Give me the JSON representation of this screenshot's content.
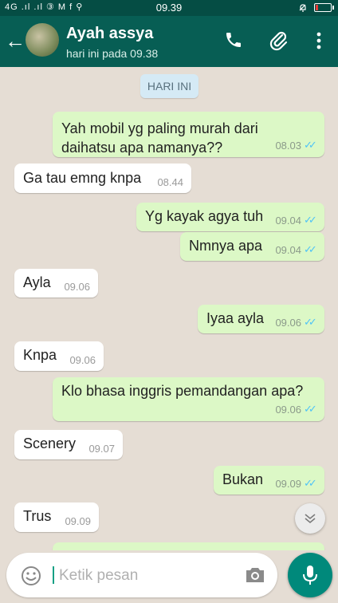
{
  "status_bar": {
    "left_indicators": "4G .ıl .ıl ③ M f ⚲",
    "time": "09.39",
    "battery_level_percent": 10,
    "icons": [
      "signal-icon",
      "mute-icon",
      "battery-icon"
    ]
  },
  "app_bar": {
    "contact_name": "Ayah assya",
    "last_seen": "hari ini pada 09.38",
    "icons": [
      "back-arrow-icon",
      "phone-icon",
      "paperclip-icon",
      "more-vert-icon"
    ]
  },
  "chat": {
    "date_chip": "HARI INI",
    "messages": [
      {
        "direction": "out",
        "lines": [
          "Yah mobil yg paling murah dari",
          "daihatsu apa namanya??"
        ],
        "time": "08.03",
        "status": "read"
      },
      {
        "direction": "in",
        "text": "Ga tau emng knpa",
        "time": "08.44"
      },
      {
        "direction": "out",
        "text": "Yg kayak agya tuh",
        "time": "09.04",
        "status": "read"
      },
      {
        "direction": "out",
        "text": "Nmnya apa",
        "time": "09.04",
        "status": "read"
      },
      {
        "direction": "in",
        "text": "Ayla",
        "time": "09.06"
      },
      {
        "direction": "out",
        "text": "Iyaa ayla",
        "time": "09.06",
        "status": "read"
      },
      {
        "direction": "in",
        "text": "Knpa",
        "time": "09.06"
      },
      {
        "direction": "out",
        "text": "Klo bhasa inggris pemandangan apa?",
        "time": "09.06",
        "status": "read"
      },
      {
        "direction": "in",
        "text": "Scenery",
        "time": "09.07"
      },
      {
        "direction": "out",
        "text": "Bukan",
        "time": "09.09",
        "status": "read"
      },
      {
        "direction": "in",
        "text": "Trus",
        "time": "09.09"
      }
    ]
  },
  "composer": {
    "placeholder": "Ketik pesan",
    "icons": [
      "emoji-icon",
      "camera-icon",
      "mic-icon",
      "scroll-down-icon"
    ]
  },
  "colors": {
    "header": "#075e54",
    "status_bar": "#054d44",
    "outgoing_bubble": "#dcf8c6",
    "incoming_bubble": "#ffffff",
    "read_ticks": "#4fc3f7",
    "mic_button": "#00897b"
  }
}
